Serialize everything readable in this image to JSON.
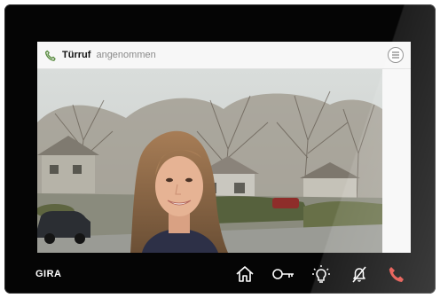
{
  "brand": "GIRA",
  "status": {
    "call_label": "Türruf",
    "state_label": "angenommen"
  },
  "icons": {
    "status": "phone-handset-icon",
    "menu": "menu-icon",
    "home": "home-icon",
    "key": "key-icon",
    "light": "light-bulb-icon",
    "mute": "bell-off-icon",
    "hangup": "hang-up-icon"
  },
  "colors": {
    "bezel": "#050505",
    "status_icon": "#5d8f45",
    "hangup": "#e4473e",
    "icon": "#ffffff"
  }
}
